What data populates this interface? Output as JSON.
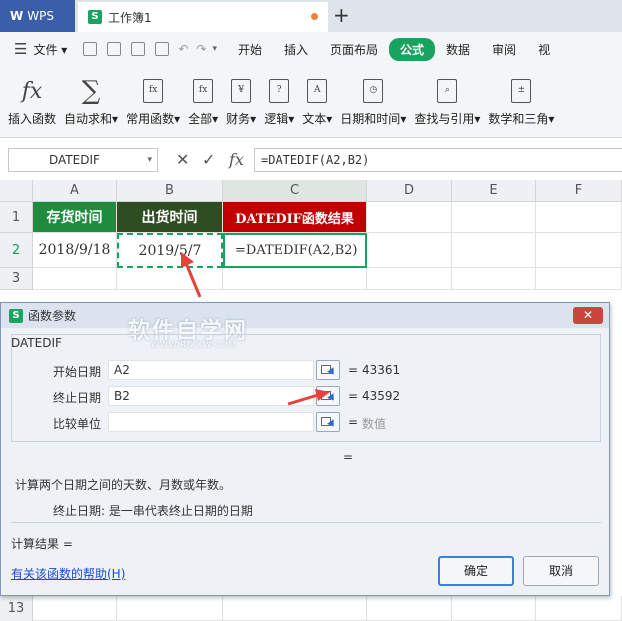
{
  "titlebar": {
    "app": "WPS",
    "doc_tab": "工作簿1"
  },
  "menubar": {
    "file": "文件",
    "tabs": [
      "开始",
      "插入",
      "页面布局",
      "公式",
      "数据",
      "审阅",
      "视"
    ]
  },
  "ribbon": {
    "items": [
      "插入函数",
      "自动求和",
      "常用函数",
      "全部",
      "财务",
      "逻辑",
      "文本",
      "日期和时间",
      "查找与引用",
      "数学和三角"
    ]
  },
  "formula_bar": {
    "name_box": "DATEDIF",
    "formula": "=DATEDIF(A2,B2)"
  },
  "grid": {
    "columns": [
      "A",
      "B",
      "C",
      "D",
      "E",
      "F"
    ],
    "rows": [
      "1",
      "2",
      "3"
    ],
    "headers": [
      "存货时间",
      "出货时间",
      "DATEDIF函数结果"
    ],
    "row2": [
      "2018/9/18",
      "2019/5/7",
      "=DATEDIF(A2,B2)"
    ],
    "last_row": "13",
    "colors": {
      "a1": "#1f8b3c",
      "b1": "#2e4d20",
      "c1": "#c00000",
      "selection": "#1aa260"
    }
  },
  "dialog": {
    "title": "函数参数",
    "close": "✕",
    "watermark": "软件自学网",
    "watermark_url": "WWW.RJZXW.COM",
    "function_name": "DATEDIF",
    "args": [
      {
        "label": "开始日期",
        "value": "A2",
        "result": "43361"
      },
      {
        "label": "终止日期",
        "value": "B2",
        "result": "43592"
      },
      {
        "label": "比较单位",
        "value": "",
        "result": "数值"
      }
    ],
    "equals": "=",
    "description": "计算两个日期之间的天数、月数或年数。",
    "param_description": "终止日期:  是一串代表终止日期的日期",
    "result_label": "计算结果  =",
    "help": "有关该函数的帮助(H)",
    "ok": "确定",
    "cancel": "取消"
  }
}
